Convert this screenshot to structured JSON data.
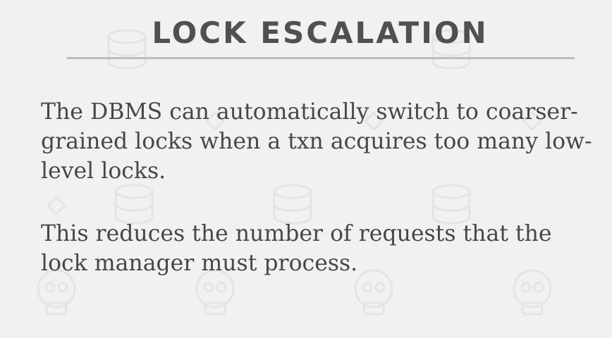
{
  "slide": {
    "title": "LOCK ESCALATION",
    "paragraphs": [
      "The DBMS can automatically switch to coarser-grained locks when a txn acquires too many low-level locks.",
      "This reduces the number of requests that the lock manager must process."
    ]
  },
  "background": {
    "icons": [
      "database-icon",
      "skull-icon"
    ],
    "color": "#e6e6e6"
  }
}
